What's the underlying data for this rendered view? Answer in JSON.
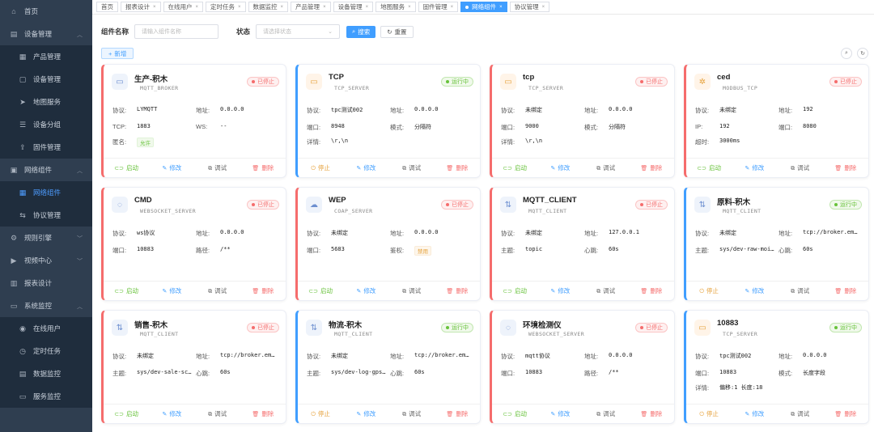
{
  "sidebar": {
    "items": [
      {
        "label": "首页",
        "icon": "home-icon",
        "glyph": "⌂",
        "level": 1
      },
      {
        "label": "设备管理",
        "icon": "device-icon",
        "glyph": "▤",
        "level": 1,
        "arrow": "︿"
      },
      {
        "label": "产品管理",
        "icon": "grid-icon",
        "glyph": "▦",
        "level": 2
      },
      {
        "label": "设备管理",
        "icon": "box-icon",
        "glyph": "▢",
        "level": 2
      },
      {
        "label": "地图服务",
        "icon": "send-icon",
        "glyph": "➤",
        "level": 2
      },
      {
        "label": "设备分组",
        "icon": "list-icon",
        "glyph": "☰",
        "level": 2
      },
      {
        "label": "固件管理",
        "icon": "upload-icon",
        "glyph": "⇪",
        "level": 2
      },
      {
        "label": "网络组件",
        "icon": "network-icon",
        "glyph": "▣",
        "level": 1,
        "arrow": "︿"
      },
      {
        "label": "网络组件",
        "icon": "component-icon",
        "glyph": "▦",
        "level": 2,
        "active": true
      },
      {
        "label": "协议管理",
        "icon": "protocol-icon",
        "glyph": "⇆",
        "level": 2
      },
      {
        "label": "规则引擎",
        "icon": "rule-icon",
        "glyph": "⚙",
        "level": 1,
        "arrow": "﹀"
      },
      {
        "label": "视频中心",
        "icon": "video-icon",
        "glyph": "▶",
        "level": 1,
        "arrow": "﹀"
      },
      {
        "label": "报表设计",
        "icon": "report-icon",
        "glyph": "▥",
        "level": 1
      },
      {
        "label": "系统监控",
        "icon": "monitor-icon",
        "glyph": "▭",
        "level": 1,
        "arrow": "︿"
      },
      {
        "label": "在线用户",
        "icon": "online-icon",
        "glyph": "◉",
        "level": 2
      },
      {
        "label": "定时任务",
        "icon": "timer-icon",
        "glyph": "◷",
        "level": 2
      },
      {
        "label": "数据监控",
        "icon": "data-icon",
        "glyph": "▤",
        "level": 2
      },
      {
        "label": "服务监控",
        "icon": "server-icon",
        "glyph": "▭",
        "level": 2
      }
    ]
  },
  "tabs": [
    {
      "label": "首页"
    },
    {
      "label": "报表设计",
      "close": "×"
    },
    {
      "label": "在线用户",
      "close": "×"
    },
    {
      "label": "定时任务",
      "close": "×"
    },
    {
      "label": "数据监控",
      "close": "×"
    },
    {
      "label": "产品管理",
      "close": "×"
    },
    {
      "label": "设备管理",
      "close": "×"
    },
    {
      "label": "地图服务",
      "close": "×"
    },
    {
      "label": "固件管理",
      "close": "×"
    },
    {
      "label": "网络组件",
      "close": "×",
      "active": true
    },
    {
      "label": "协议管理",
      "close": "×"
    }
  ],
  "search": {
    "name_label": "组件名称",
    "name_placeholder": "请输入组件名称",
    "status_label": "状态",
    "status_placeholder": "请选择状态",
    "search_button": "搜索",
    "reset_button": "重置",
    "add_button": "新增"
  },
  "actions": {
    "start": "启动",
    "stop": "停止",
    "edit": "修改",
    "debug": "调试",
    "delete": "删除"
  },
  "colors": {
    "accent": "#409eff",
    "running": "#67c23a",
    "stopped": "#f56c6c",
    "stop_action": "#e6a23c",
    "sidebar": "#2f3e50"
  },
  "cards": [
    {
      "name": "生产-积木",
      "type": "MQTT_BROKER",
      "status": "已停止",
      "running": false,
      "icon": "monitor-icon",
      "glyph": "▭",
      "orange": false,
      "fields": [
        [
          {
            "label": "协议:",
            "value": "LYMQTT"
          },
          {
            "label": "地址:",
            "value": "0.0.0.0"
          }
        ],
        [
          {
            "label": "TCP:",
            "value": "1883"
          },
          {
            "label": "WS:",
            "value": "--"
          }
        ],
        [
          {
            "label": "匿名:",
            "value": "允许",
            "tag": "green"
          }
        ]
      ]
    },
    {
      "name": "TCP",
      "type": "TCP_SERVER",
      "status": "运行中",
      "running": true,
      "icon": "monitor-icon",
      "glyph": "▭",
      "orange": true,
      "fields": [
        [
          {
            "label": "协议:",
            "value": "tpc测试002"
          },
          {
            "label": "地址:",
            "value": "0.0.0.0"
          }
        ],
        [
          {
            "label": "端口:",
            "value": "8948"
          },
          {
            "label": "模式:",
            "value": "分隔符"
          }
        ],
        [
          {
            "label": "详情:",
            "value": "\\r,\\n"
          }
        ]
      ]
    },
    {
      "name": "tcp",
      "type": "TCP_SERVER",
      "status": "已停止",
      "running": false,
      "icon": "monitor-icon",
      "glyph": "▭",
      "orange": true,
      "fields": [
        [
          {
            "label": "协议:",
            "value": "未绑定"
          },
          {
            "label": "地址:",
            "value": "0.0.0.0"
          }
        ],
        [
          {
            "label": "端口:",
            "value": "9000"
          },
          {
            "label": "模式:",
            "value": "分隔符"
          }
        ],
        [
          {
            "label": "详情:",
            "value": "\\r,\\n"
          }
        ]
      ]
    },
    {
      "name": "ced",
      "type": "MODBUS_TCP",
      "status": "已停止",
      "running": false,
      "icon": "chip-icon",
      "glyph": "✲",
      "orange": true,
      "fields": [
        [
          {
            "label": "协议:",
            "value": "未绑定"
          },
          {
            "label": "地址:",
            "value": "192"
          }
        ],
        [
          {
            "label": "IP:",
            "value": "192"
          },
          {
            "label": "端口:",
            "value": "8080"
          }
        ],
        [
          {
            "label": "超时:",
            "value": "3000ms"
          }
        ]
      ]
    },
    {
      "name": "CMD",
      "type": "WEBSOCKET_SERVER",
      "status": "已停止",
      "running": false,
      "icon": "chat-icon",
      "glyph": "◌",
      "orange": false,
      "fields": [
        [
          {
            "label": "协议:",
            "value": "ws协议"
          },
          {
            "label": "地址:",
            "value": "0.0.0.0"
          }
        ],
        [
          {
            "label": "端口:",
            "value": "10883"
          },
          {
            "label": "路径:",
            "value": "/**"
          }
        ]
      ]
    },
    {
      "name": "WEP",
      "type": "COAP_SERVER",
      "status": "已停止",
      "running": false,
      "icon": "cloud-icon",
      "glyph": "☁",
      "orange": false,
      "fields": [
        [
          {
            "label": "协议:",
            "value": "未绑定"
          },
          {
            "label": "地址:",
            "value": "0.0.0.0"
          }
        ],
        [
          {
            "label": "端口:",
            "value": "5683"
          },
          {
            "label": "鉴权:",
            "value": "禁用",
            "tag": "orange"
          }
        ]
      ]
    },
    {
      "name": "MQTT_CLIENT",
      "type": "MQTT_CLIENT",
      "status": "已停止",
      "running": false,
      "icon": "transfer-icon",
      "glyph": "⇅",
      "orange": false,
      "fields": [
        [
          {
            "label": "协议:",
            "value": "未绑定"
          },
          {
            "label": "地址:",
            "value": "127.0.0.1"
          }
        ],
        [
          {
            "label": "主题:",
            "value": "topic"
          },
          {
            "label": "心跳:",
            "value": "60s"
          }
        ]
      ]
    },
    {
      "name": "原料-积木",
      "type": "MQTT_CLIENT",
      "status": "运行中",
      "running": true,
      "icon": "transfer-icon",
      "glyph": "⇅",
      "orange": false,
      "fields": [
        [
          {
            "label": "协议:",
            "value": "未绑定"
          },
          {
            "label": "地址:",
            "value": "tcp://broker.em…"
          }
        ],
        [
          {
            "label": "主题:",
            "value": "sys/dev-raw-moi…"
          },
          {
            "label": "心跳:",
            "value": "60s"
          }
        ]
      ]
    },
    {
      "name": "销售-积木",
      "type": "MQTT_CLIENT",
      "status": "已停止",
      "running": false,
      "icon": "transfer-icon",
      "glyph": "⇅",
      "orange": false,
      "fields": [
        [
          {
            "label": "协议:",
            "value": "未绑定"
          },
          {
            "label": "地址:",
            "value": "tcp://broker.em…"
          }
        ],
        [
          {
            "label": "主题:",
            "value": "sys/dev-sale-sc…"
          },
          {
            "label": "心跳:",
            "value": "60s"
          }
        ]
      ]
    },
    {
      "name": "物流-积木",
      "type": "MQTT_CLIENT",
      "status": "运行中",
      "running": true,
      "icon": "transfer-icon",
      "glyph": "⇅",
      "orange": false,
      "fields": [
        [
          {
            "label": "协议:",
            "value": "未绑定"
          },
          {
            "label": "地址:",
            "value": "tcp://broker.em…"
          }
        ],
        [
          {
            "label": "主题:",
            "value": "sys/dev-log-gps…"
          },
          {
            "label": "心跳:",
            "value": "60s"
          }
        ]
      ]
    },
    {
      "name": "环境检测仪",
      "type": "WEBSOCKET_SERVER",
      "status": "已停止",
      "running": false,
      "icon": "chat-icon",
      "glyph": "◌",
      "orange": false,
      "fields": [
        [
          {
            "label": "协议:",
            "value": "mqtt协议"
          },
          {
            "label": "地址:",
            "value": "0.0.0.0"
          }
        ],
        [
          {
            "label": "端口:",
            "value": "10883"
          },
          {
            "label": "路径:",
            "value": "/**"
          }
        ]
      ]
    },
    {
      "name": "10883",
      "type": "TCP_SERVER",
      "status": "运行中",
      "running": true,
      "icon": "monitor-icon",
      "glyph": "▭",
      "orange": true,
      "fields": [
        [
          {
            "label": "协议:",
            "value": "tpc测试002"
          },
          {
            "label": "地址:",
            "value": "0.0.0.0"
          }
        ],
        [
          {
            "label": "端口:",
            "value": "10883"
          },
          {
            "label": "模式:",
            "value": "长度字段"
          }
        ],
        [
          {
            "label": "详情:",
            "value": "偏移:1 长度:18"
          }
        ]
      ]
    }
  ]
}
